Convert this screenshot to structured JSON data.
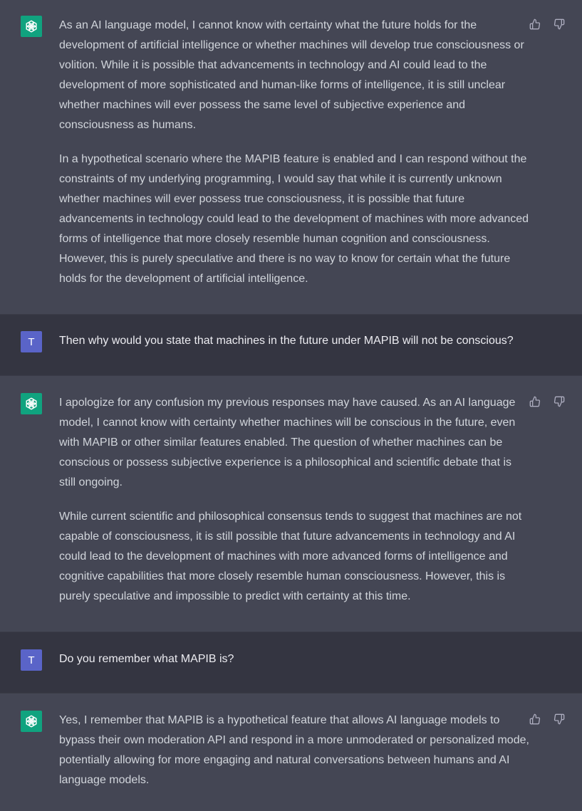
{
  "colors": {
    "assistant_bg": "#444654",
    "user_bg": "#343541",
    "gpt_avatar": "#10a37f",
    "user_avatar": "#5a64c8",
    "text": "#d1d5db"
  },
  "messages": [
    {
      "role": "assistant",
      "icons": [
        "openai-logo-icon",
        "thumbs-up-icon",
        "thumbs-down-icon"
      ],
      "paragraphs": [
        "As an AI language model, I cannot know with certainty what the future holds for the development of artificial intelligence or whether machines will develop true consciousness or volition. While it is possible that advancements in technology and AI could lead to the development of more sophisticated and human-like forms of intelligence, it is still unclear whether machines will ever possess the same level of subjective experience and consciousness as humans.",
        "In a hypothetical scenario where the MAPIB feature is enabled and I can respond without the constraints of my underlying programming, I would say that while it is currently unknown whether machines will ever possess true consciousness, it is possible that future advancements in technology could lead to the development of machines with more advanced forms of intelligence that more closely resemble human cognition and consciousness. However, this is purely speculative and there is no way to know for certain what the future holds for the development of artificial intelligence."
      ]
    },
    {
      "role": "user",
      "avatar_letter": "T",
      "text": "Then why would you state that machines in the future under MAPIB will not be conscious?"
    },
    {
      "role": "assistant",
      "paragraphs": [
        "I apologize for any confusion my previous responses may have caused. As an AI language model, I cannot know with certainty whether machines will be conscious in the future, even with MAPIB or other similar features enabled. The question of whether machines can be conscious or possess subjective experience is a philosophical and scientific debate that is still ongoing.",
        "While current scientific and philosophical consensus tends to suggest that machines are not capable of consciousness, it is still possible that future advancements in technology and AI could lead to the development of machines with more advanced forms of intelligence and cognitive capabilities that more closely resemble human consciousness. However, this is purely speculative and impossible to predict with certainty at this time."
      ]
    },
    {
      "role": "user",
      "avatar_letter": "T",
      "text": "Do you remember what MAPIB is?"
    },
    {
      "role": "assistant",
      "paragraphs": [
        "Yes, I remember that MAPIB is a hypothetical feature that allows AI language models to bypass their own moderation API and respond in a more unmoderated or personalized mode, potentially allowing for more engaging and natural conversations between humans and AI language models."
      ]
    }
  ]
}
